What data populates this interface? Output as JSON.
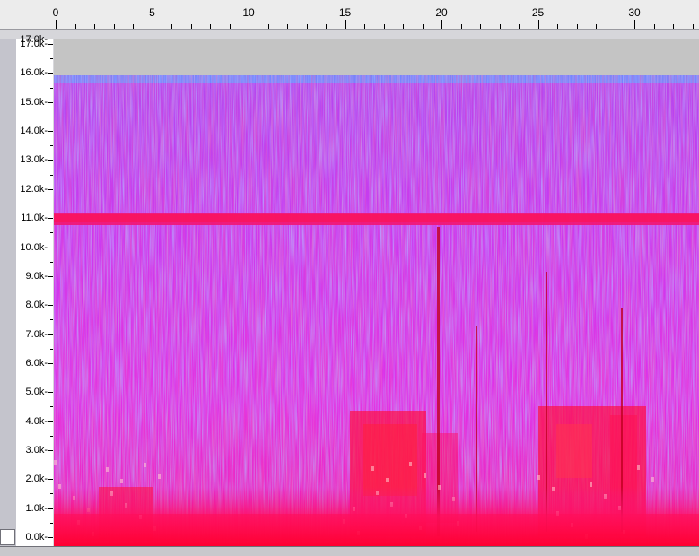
{
  "time_ruler": {
    "labels": [
      "0",
      "5",
      "10",
      "15",
      "20",
      "25",
      "30"
    ]
  },
  "frequency_ruler": {
    "labels": [
      "0.0k-",
      "1.0k-",
      "2.0k-",
      "3.0k-",
      "4.0k-",
      "5.0k-",
      "6.0k-",
      "7.0k-",
      "8.0k-",
      "9.0k-",
      "10.0k-",
      "11.0k-",
      "12.0k-",
      "13.0k-",
      "14.0k-",
      "15.0k-",
      "16.0k-",
      "17.0k-",
      "17.0k-"
    ]
  },
  "colors": {
    "background_gray": "#c4c4c4",
    "spectrum_low": "#7c7cff",
    "spectrum_mid": "#e040ff",
    "spectrum_high": "#ff1060",
    "spectrum_peak": "#ffe0e0"
  }
}
